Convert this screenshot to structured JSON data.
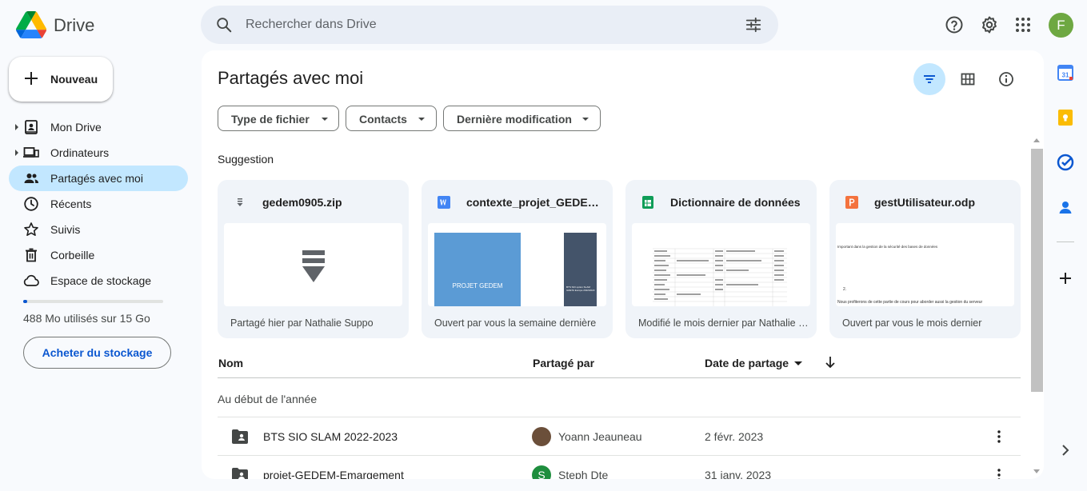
{
  "app": {
    "name": "Drive",
    "avatar_letter": "F",
    "avatar_color": "#6ea842"
  },
  "search": {
    "placeholder": "Rechercher dans Drive"
  },
  "sidebar": {
    "new_label": "Nouveau",
    "items": [
      {
        "label": "Mon Drive",
        "icon": "my-drive-icon",
        "expandable": true,
        "active": false
      },
      {
        "label": "Ordinateurs",
        "icon": "computers-icon",
        "expandable": true,
        "active": false
      },
      {
        "label": "Partagés avec moi",
        "icon": "shared-people-icon",
        "expandable": false,
        "active": true
      },
      {
        "label": "Récents",
        "icon": "clock-icon",
        "expandable": false,
        "active": false
      },
      {
        "label": "Suivis",
        "icon": "star-icon",
        "expandable": false,
        "active": false
      },
      {
        "label": "Corbeille",
        "icon": "trash-icon",
        "expandable": false,
        "active": false
      },
      {
        "label": "Espace de stockage",
        "icon": "cloud-icon",
        "expandable": false,
        "active": false
      }
    ],
    "storage_text": "488 Mo utilisés sur 15 Go",
    "storage_used_fraction": 0.03,
    "buy_storage_label": "Acheter du stockage"
  },
  "main": {
    "title": "Partagés avec moi",
    "filters": [
      "Type de fichier",
      "Contacts",
      "Dernière modification"
    ],
    "suggestion_title": "Suggestion",
    "suggestions": [
      {
        "name": "gedem0905.zip",
        "type": "zip",
        "subtitle": "Partagé hier par Nathalie Suppo"
      },
      {
        "name": "contexte_projet_GEDEM.docx",
        "type": "word",
        "subtitle": "Ouvert par vous la semaine dernière",
        "preview_text": "PROJET GEDEM",
        "preview_side_text": "BTS SIO option SLAM GRETA Europe 2022/2023"
      },
      {
        "name": "Dictionnaire de données",
        "type": "sheets",
        "subtitle": "Modifié le mois dernier par Nathalie Suppo"
      },
      {
        "name": "gestUtilisateur.odp",
        "type": "slides",
        "subtitle": "Ouvert par vous le mois dernier",
        "preview_line1": "Important dans la gestion de la sécurité des bases de données",
        "preview_line2": "2.",
        "preview_line3": "Nous profiterons de cette partie de cours pour aborder aussi la gestion du serveur"
      }
    ],
    "columns": {
      "name": "Nom",
      "shared_by": "Partagé par",
      "date": "Date de partage"
    },
    "group_label": "Au début de l'année",
    "rows": [
      {
        "name": "BTS SIO SLAM 2022-2023",
        "icon": "shared-folder-icon",
        "shared_by": "Yoann Jeauneau",
        "avatar": "",
        "avatar_color": "#6b4f3a",
        "date": "2 févr. 2023"
      },
      {
        "name": "projet-GEDEM-Emargement",
        "icon": "shared-folder-icon",
        "shared_by": "Steph Dte",
        "avatar": "S",
        "avatar_color": "#1e8e3e",
        "date": "31 janv. 2023"
      }
    ]
  },
  "colors": {
    "accent": "#0b57d0",
    "active_bg": "#c2e7ff",
    "search_bg": "#e9eef6"
  }
}
